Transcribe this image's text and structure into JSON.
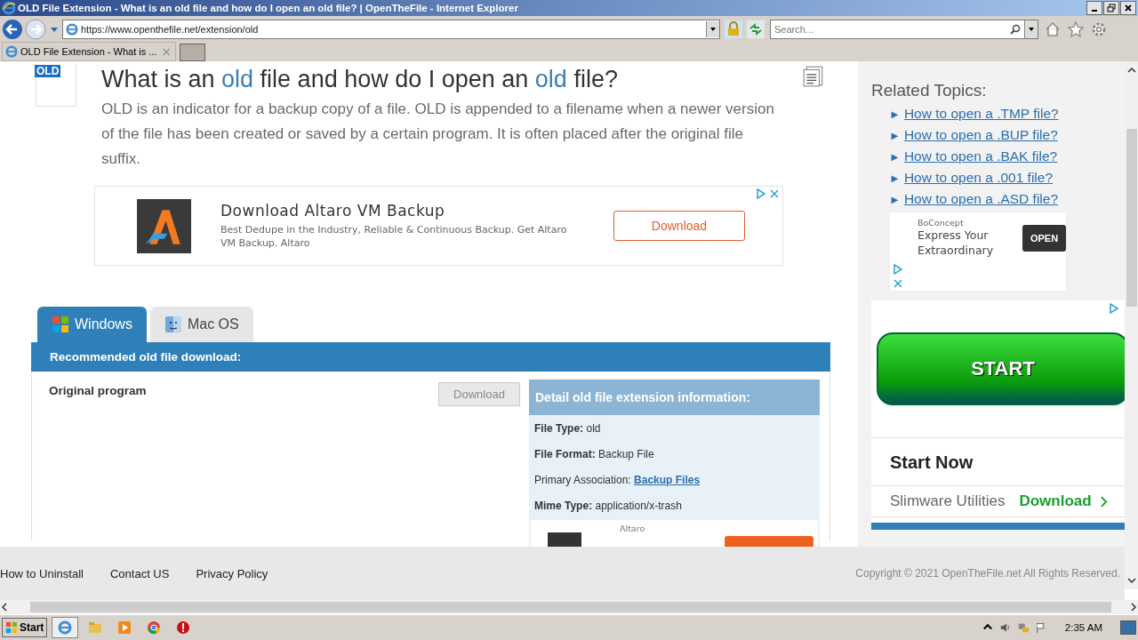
{
  "browser": {
    "title": "OLD File Extension - What is an old file and how do I open an old file? | OpenTheFile - Internet Explorer",
    "url": "https://www.openthefile.net/extension/old",
    "search": {
      "placeholder": "Search..."
    },
    "tab": {
      "label": "OLD File Extension - What is ...",
      "close": "×"
    }
  },
  "page": {
    "file_badge": "OLD",
    "heading": [
      {
        "text": "What is an ",
        "highlight": false
      },
      {
        "text": "old",
        "highlight": true
      },
      {
        "text": " file and how do I open an ",
        "highlight": false
      },
      {
        "text": "old",
        "highlight": true
      },
      {
        "text": " file?",
        "highlight": false
      }
    ],
    "description": "OLD is an indicator for a backup copy of a file. OLD is appended to a filename when a newer version of the file has been created or saved by a certain program. It is often placed after the original file suffix.",
    "ad": {
      "title": "Download Altaro VM Backup",
      "text": "Best Dedupe in the Industry, Reliable & Continuous Backup. Get Altaro VM Backup. Altaro",
      "button": "Download"
    },
    "os_tabs": [
      {
        "label": "Windows",
        "selected": true,
        "kind": "windows"
      },
      {
        "label": "Mac OS",
        "selected": false,
        "kind": "mac"
      }
    ],
    "recommended": "Recommended old file download:",
    "original_program": "Original program",
    "download_button": {
      "label": "Download",
      "disabled": true
    },
    "detail": {
      "title": "Detail old file extension information:",
      "rows": [
        {
          "label": "File Type:",
          "value": "old",
          "kind": "field"
        },
        {
          "label": "File Format:",
          "value": "Backup File",
          "kind": "field"
        },
        {
          "label": "Primary Association:",
          "value": "Backup Files",
          "kind": "link"
        },
        {
          "label": "Mime Type:",
          "value": "application/x-trash",
          "kind": "field"
        }
      ],
      "ad_brand": "Altaro"
    }
  },
  "sidebar": {
    "title": "Related Topics:",
    "links": [
      {
        "arrow": "►",
        "text": "How to open a .TMP file?"
      },
      {
        "arrow": "►",
        "text": "How to open a .BUP file?"
      },
      {
        "arrow": "►",
        "text": "How to open a .BAK file?"
      },
      {
        "arrow": "►",
        "text": "How to open a .001 file?"
      },
      {
        "arrow": "►",
        "text": "How to open a .ASD file?"
      }
    ],
    "ad_small": {
      "brand": "BoConcept",
      "headline": "Express Your Extraordinary",
      "button": "OPEN"
    },
    "ad_large": {
      "button": "START",
      "title": "Start Now",
      "advertiser": "Slimware Utilities",
      "action": "Download"
    }
  },
  "footer": {
    "links": [
      "How to Uninstall",
      "Contact US",
      "Privacy Policy"
    ],
    "copyright": "Copyright © 2021 OpenTheFile.net All Rights Reserved."
  },
  "taskbar": {
    "start": "Start",
    "time": "2:35 AM"
  }
}
